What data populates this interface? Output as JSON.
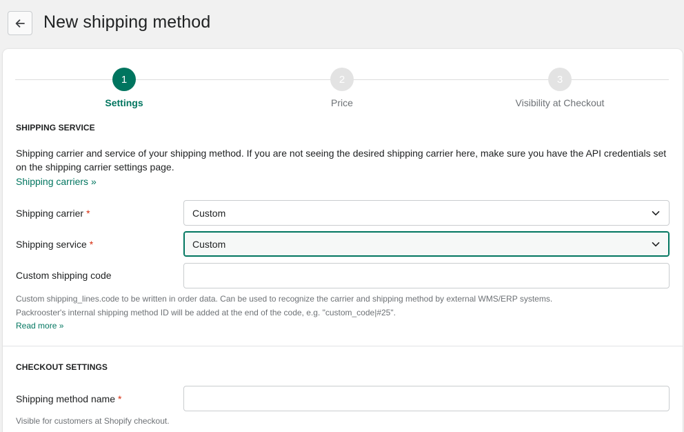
{
  "header": {
    "title": "New shipping method",
    "back_icon": "arrow-left-icon"
  },
  "stepper": {
    "steps": [
      {
        "number": "1",
        "label": "Settings",
        "state": "active"
      },
      {
        "number": "2",
        "label": "Price",
        "state": "inactive"
      },
      {
        "number": "3",
        "label": "Visibility at Checkout",
        "state": "inactive"
      }
    ]
  },
  "shipping_service": {
    "heading": "SHIPPING SERVICE",
    "description": "Shipping carrier and service of your shipping method. If you are not seeing the desired shipping carrier here, make sure you have the API credentials set on the shipping carrier settings page.",
    "carriers_link": "Shipping carriers »",
    "carrier_label": "Shipping carrier",
    "carrier_value": "Custom",
    "service_label": "Shipping service",
    "service_value": "Custom",
    "custom_code_label": "Custom shipping code",
    "custom_code_value": "",
    "custom_code_help_1": "Custom shipping_lines.code to be written in order data. Can be used to recognize the carrier and shipping method by external WMS/ERP systems.",
    "custom_code_help_2": "Packrooster's internal shipping method ID will be added at the end of the code, e.g. \"custom_code|#25\".",
    "read_more": "Read more »"
  },
  "checkout_settings": {
    "heading": "CHECKOUT SETTINGS",
    "method_name_label": "Shipping method name",
    "method_name_value": "",
    "method_name_help": "Visible for customers at Shopify checkout."
  },
  "required_marker": "*",
  "colors": {
    "accent": "#00755f",
    "required": "#d72c0d",
    "background": "#f1f1f1"
  }
}
